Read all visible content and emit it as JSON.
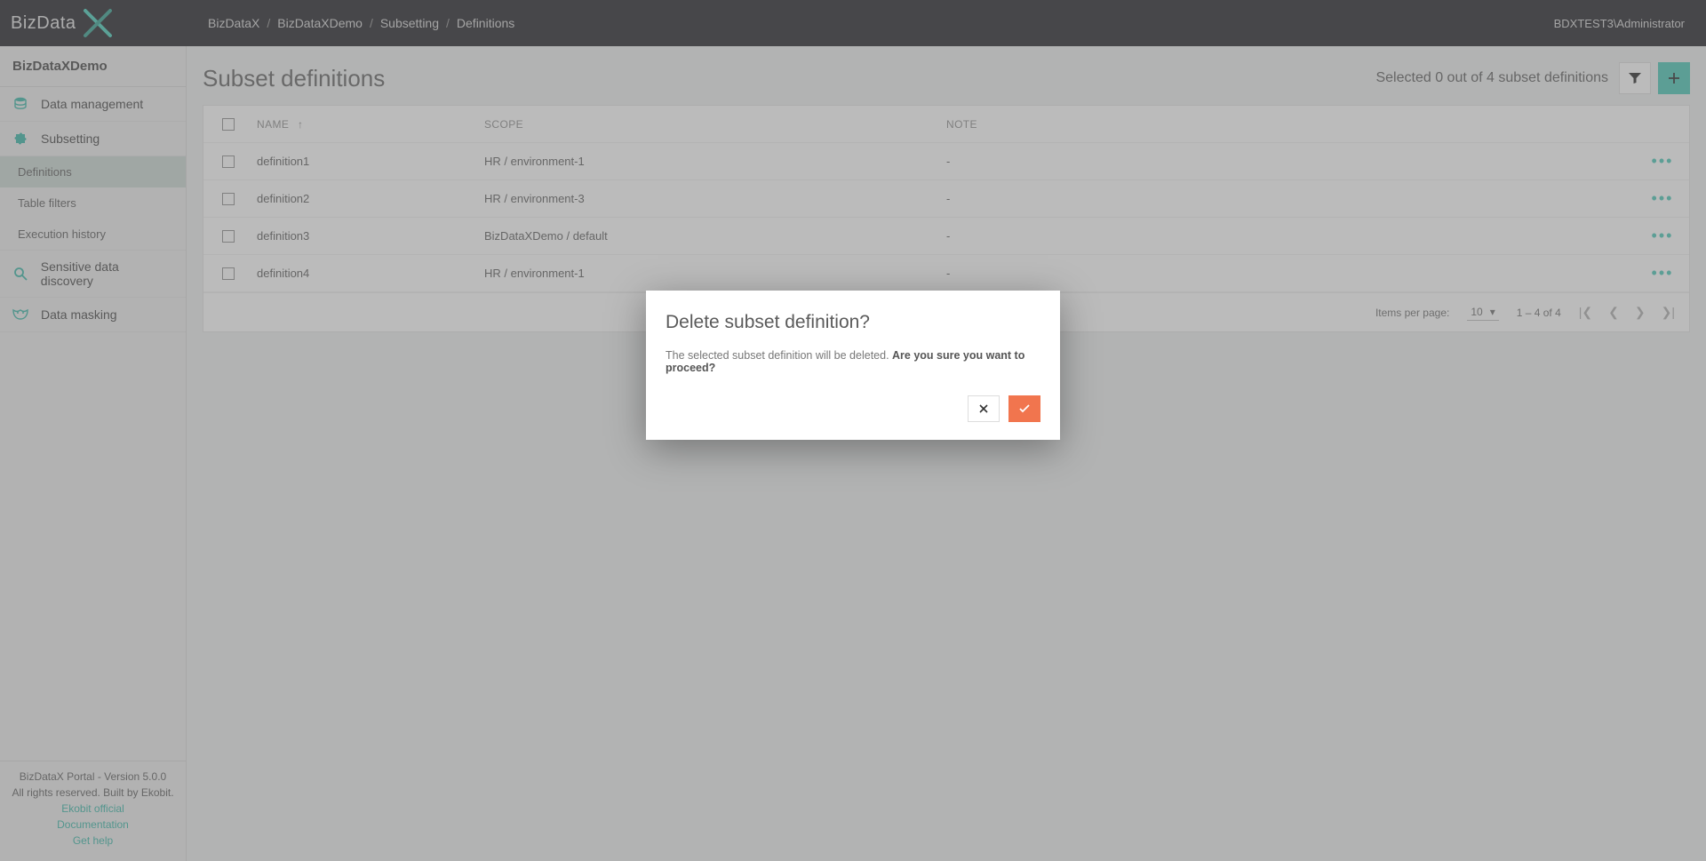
{
  "topbar": {
    "logo_text": "BizData",
    "breadcrumbs": [
      "BizDataX",
      "BizDataXDemo",
      "Subsetting",
      "Definitions"
    ],
    "user": "BDXTEST3\\Administrator"
  },
  "sidebar": {
    "workspace": "BizDataXDemo",
    "items": [
      {
        "label": "Data management",
        "icon": "database-icon"
      },
      {
        "label": "Subsetting",
        "icon": "puzzle-icon",
        "children": [
          {
            "label": "Definitions",
            "active": true
          },
          {
            "label": "Table filters"
          },
          {
            "label": "Execution history"
          }
        ]
      },
      {
        "label": "Sensitive data discovery",
        "icon": "search-icon"
      },
      {
        "label": "Data masking",
        "icon": "mask-icon"
      }
    ],
    "footer": {
      "line1": "BizDataX Portal - Version 5.0.0",
      "line2": "All rights reserved. Built by Ekobit.",
      "links": [
        "Ekobit official",
        "Documentation",
        "Get help"
      ]
    }
  },
  "page": {
    "title": "Subset definitions",
    "selection_text": "Selected 0 out of 4 subset definitions"
  },
  "table": {
    "columns": {
      "name": "NAME",
      "scope": "SCOPE",
      "note": "NOTE"
    },
    "rows": [
      {
        "name": "definition1",
        "scope": "HR  /  environment-1",
        "note": "-"
      },
      {
        "name": "definition2",
        "scope": "HR  /  environment-3",
        "note": "-"
      },
      {
        "name": "definition3",
        "scope": "BizDataXDemo  /  default",
        "note": "-"
      },
      {
        "name": "definition4",
        "scope": "HR  /  environment-1",
        "note": "-"
      }
    ]
  },
  "paginator": {
    "items_per_page_label": "Items per page:",
    "items_per_page_value": "10",
    "range_text": "1 – 4 of 4"
  },
  "modal": {
    "title": "Delete subset definition?",
    "text_plain": "The selected subset definition will be deleted. ",
    "text_strong": "Are you sure you want to proceed?"
  }
}
